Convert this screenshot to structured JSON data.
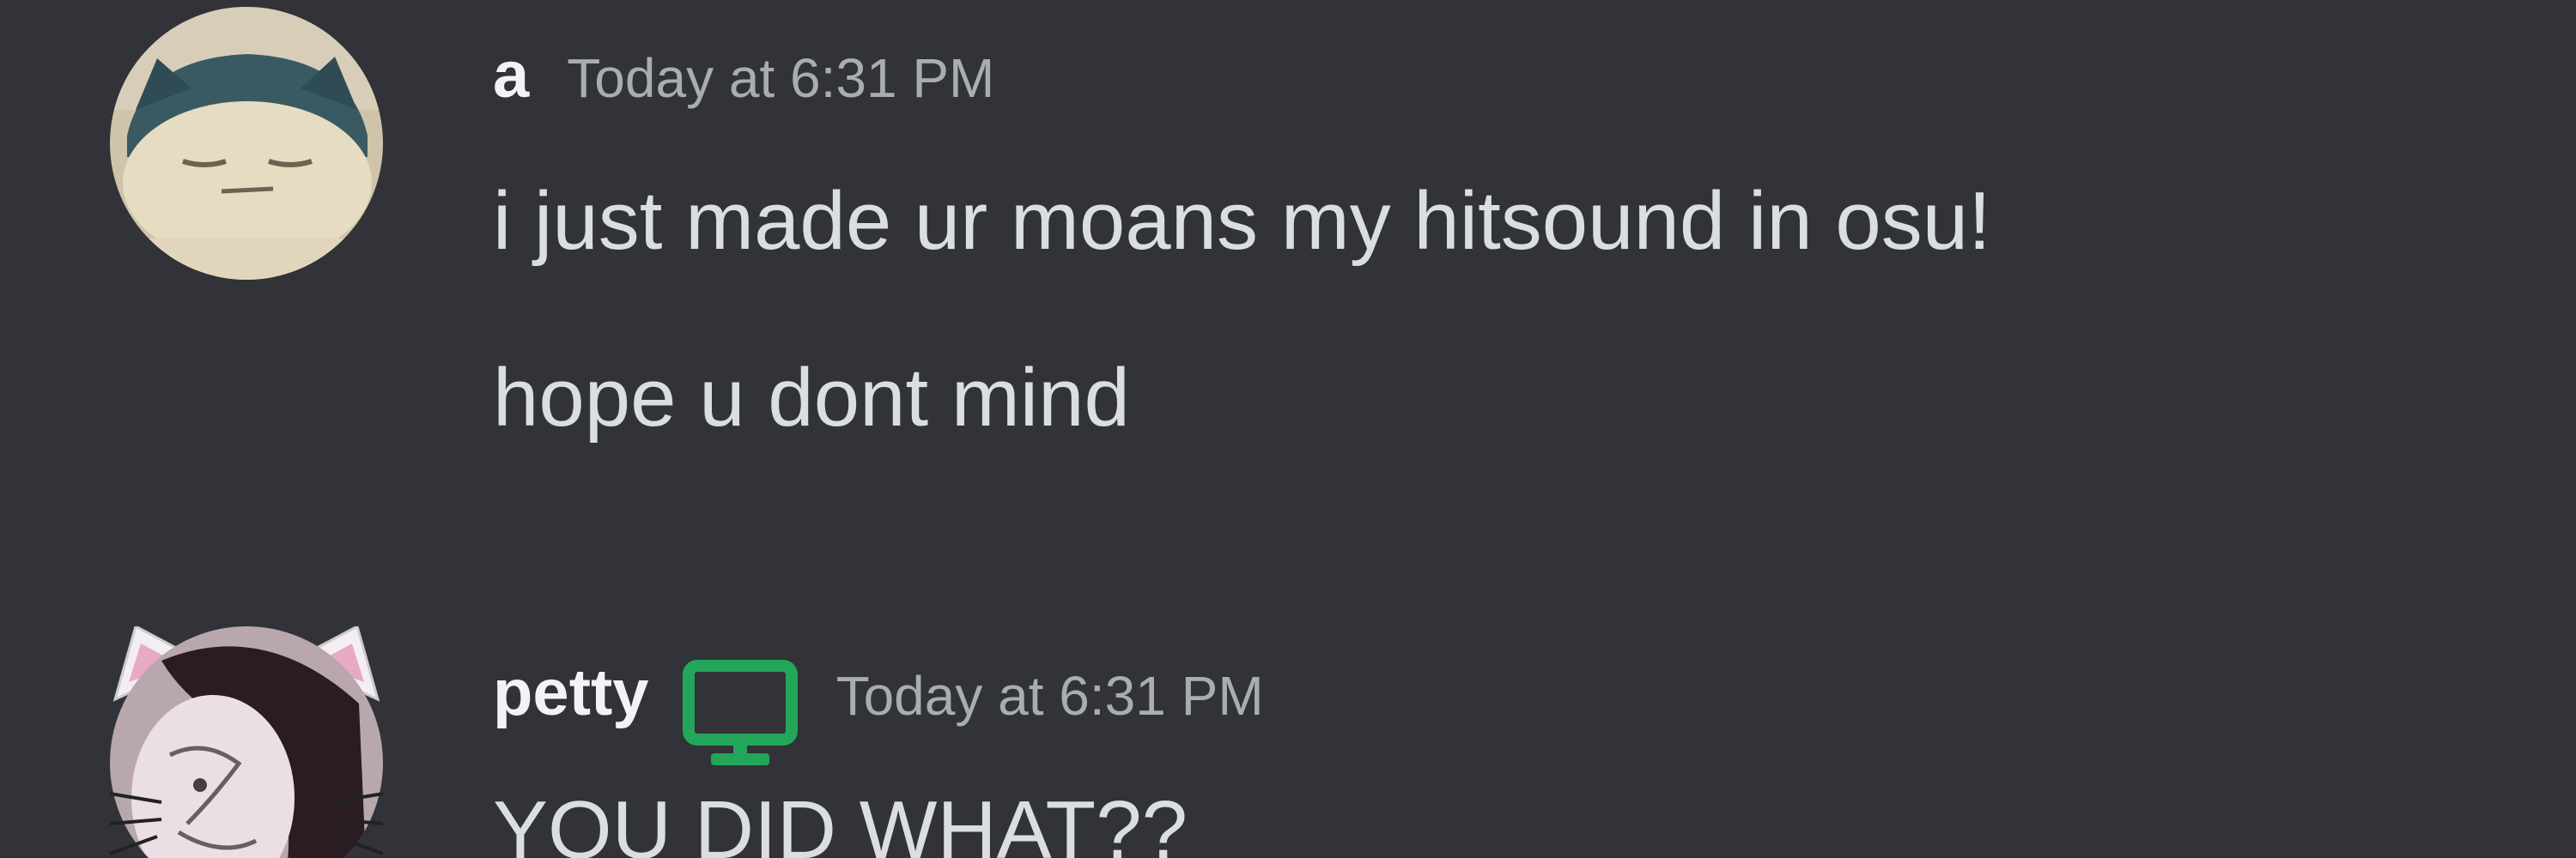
{
  "messages": [
    {
      "username": "a",
      "timestamp": "Today at 6:31 PM",
      "avatar_icon": "snorlax-avatar",
      "lines": [
        "i just made ur moans my hitsound in osu!",
        "hope u dont mind"
      ]
    },
    {
      "username": "petty",
      "timestamp": "Today at 6:31 PM",
      "avatar_icon": "cat-ear-avatar",
      "status_icon": "desktop-online-icon",
      "status_color": "#23a55a",
      "lines": [
        "YOU DID WHAT??"
      ]
    }
  ],
  "colors": {
    "background": "#313338",
    "username": "#f2f3f5",
    "timestamp": "#a9acb3",
    "message_text": "#dbdee1"
  }
}
